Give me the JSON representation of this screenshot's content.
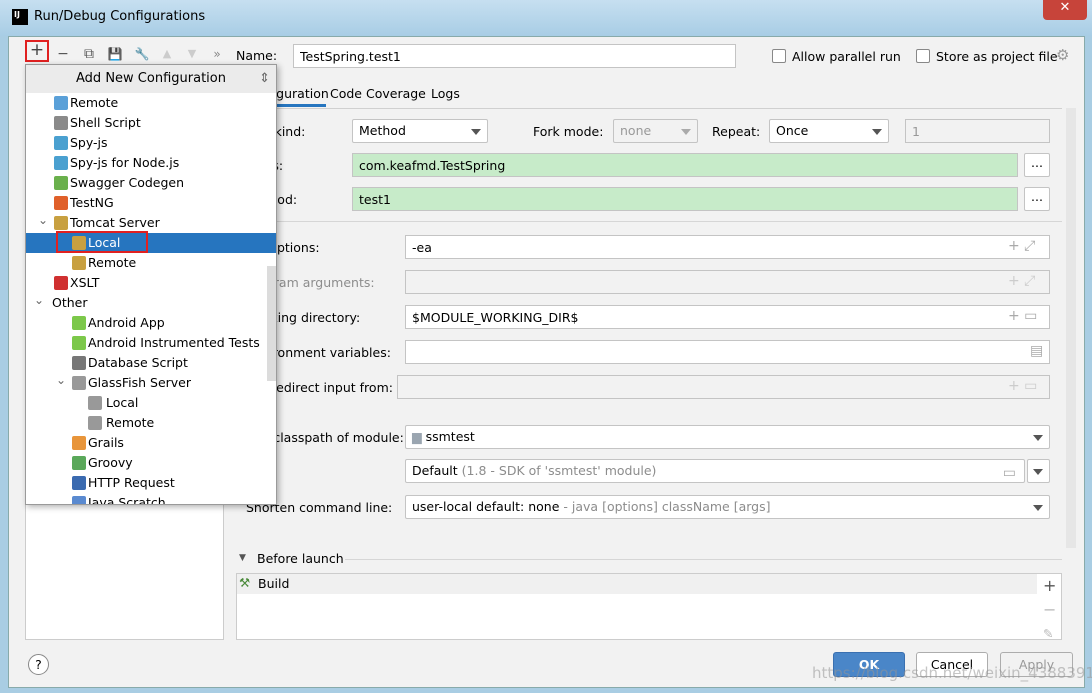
{
  "window": {
    "title": "Run/Debug Configurations",
    "app_icon": "IJ",
    "close": "✕"
  },
  "toolbar": {
    "add": "+",
    "remove": "−",
    "copy": "⧉",
    "save": "💾",
    "edit": "🔧",
    "up": "▲",
    "down": "▼",
    "more": "»"
  },
  "name": {
    "label": "Name:",
    "value": "TestSpring.test1"
  },
  "options": {
    "parallel": "Allow parallel run",
    "store": "Store as project file"
  },
  "tabs": [
    {
      "label": "Configuration"
    },
    {
      "label": "Code Coverage"
    },
    {
      "label": "Logs"
    }
  ],
  "form": {
    "test_kind_label": "Test kind:",
    "test_kind": "Method",
    "fork_label": "Fork mode:",
    "fork": "none",
    "repeat_label": "Repeat:",
    "repeat": "Once",
    "repeat_count": "1",
    "class_label": "Class:",
    "class": "com.keafmd.TestSpring",
    "method_label": "Method:",
    "method": "test1",
    "vm_label": "VM options:",
    "vm": "-ea",
    "prog_label": "Program arguments:",
    "wd_label": "Working directory:",
    "wd": "$MODULE_WORKING_DIR$",
    "env_label": "Environment variables:",
    "redirect_label": "Redirect input from:",
    "cp_label": "Use classpath of module:",
    "cp": "ssmtest",
    "jre": "Default",
    "jre_hint": "(1.8 - SDK of 'ssmtest' module)",
    "shorten_label": "Shorten command line:",
    "shorten": "user-local default: none",
    "shorten_hint": "- java [options] className [args]",
    "ellipsis": "..."
  },
  "before_launch": {
    "label": "Before launch",
    "items": [
      "Build"
    ]
  },
  "popup": {
    "title": "Add New Configuration",
    "items": [
      {
        "label": "Remote",
        "level": 1,
        "color": "#5aa0d8"
      },
      {
        "label": "Shell Script",
        "level": 1,
        "color": "#8a8a8a"
      },
      {
        "label": "Spy-js",
        "level": 1,
        "color": "#4aa0d0"
      },
      {
        "label": "Spy-js for Node.js",
        "level": 1,
        "color": "#4aa0d0"
      },
      {
        "label": "Swagger Codegen",
        "level": 1,
        "color": "#6ab04c"
      },
      {
        "label": "TestNG",
        "level": 1,
        "color": "#e0602a"
      },
      {
        "label": "Tomcat Server",
        "level": 1,
        "color": "#c8a040",
        "expanded": true
      },
      {
        "label": "Local",
        "level": 2,
        "color": "#c8a040",
        "selected": true
      },
      {
        "label": "Remote",
        "level": 2,
        "color": "#c8a040"
      },
      {
        "label": "XSLT",
        "level": 1,
        "color": "#d03030"
      },
      {
        "label": "Other",
        "level": 0,
        "expanded": true
      },
      {
        "label": "Android App",
        "level": 2,
        "color": "#7cc84a"
      },
      {
        "label": "Android Instrumented Tests",
        "level": 2,
        "color": "#7cc84a"
      },
      {
        "label": "Database Script",
        "level": 2,
        "color": "#777"
      },
      {
        "label": "GlassFish Server",
        "level": 2,
        "color": "#999",
        "expanded": true
      },
      {
        "label": "Local",
        "level": 3,
        "color": "#999"
      },
      {
        "label": "Remote",
        "level": 3,
        "color": "#999"
      },
      {
        "label": "Grails",
        "level": 2,
        "color": "#e8953a"
      },
      {
        "label": "Groovy",
        "level": 2,
        "color": "#5aa85a"
      },
      {
        "label": "HTTP Request",
        "level": 2,
        "color": "#3a6ab0"
      },
      {
        "label": "Java Scratch",
        "level": 2,
        "color": "#5a8ad0"
      }
    ]
  },
  "buttons": {
    "ok": "OK",
    "cancel": "Cancel",
    "apply": "Apply",
    "help": "?"
  },
  "watermark": "https://blog.csdn.net/weixin_43883917",
  "colors": {
    "accent": "#2675bf",
    "green_field": "#c7ebc9",
    "highlight": "#e02020"
  }
}
